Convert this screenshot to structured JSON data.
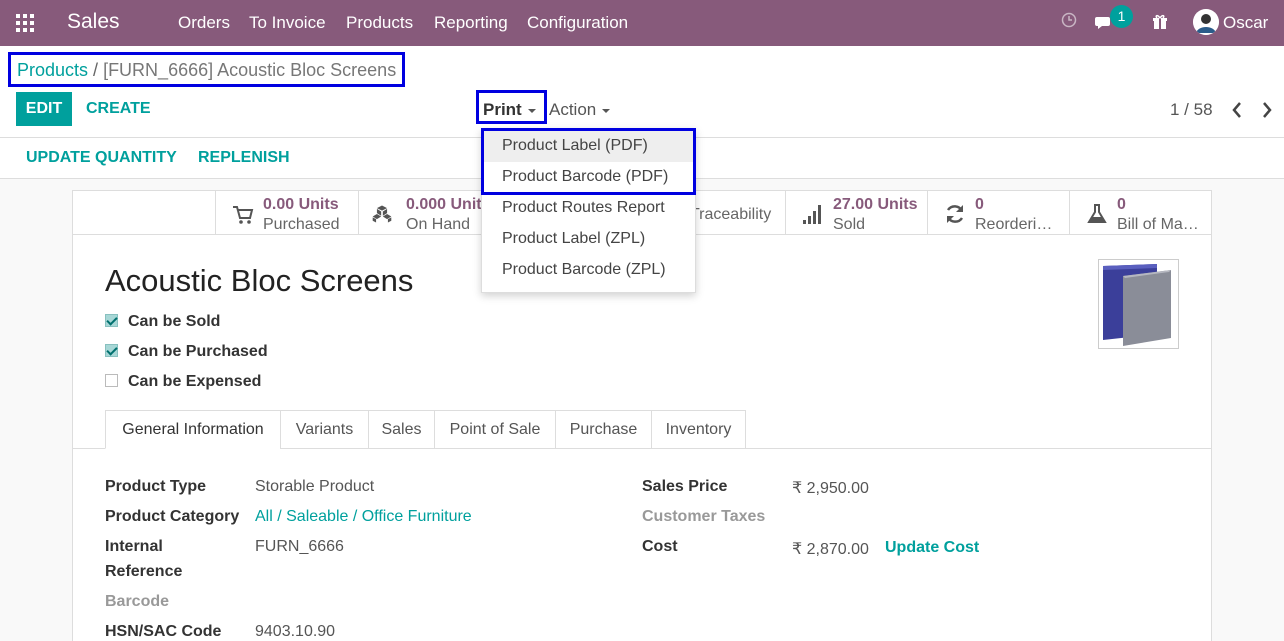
{
  "app": {
    "name": "Sales",
    "menu": [
      "Orders",
      "To Invoice",
      "Products",
      "Reporting",
      "Configuration"
    ],
    "messages_badge": "1",
    "user": "Oscar"
  },
  "breadcrumb": {
    "parent": "Products",
    "separator": "/",
    "current": "[FURN_6666] Acoustic Bloc Screens"
  },
  "toolbar": {
    "edit": "EDIT",
    "create": "CREATE",
    "print": "Print",
    "action": "Action",
    "pager": "1 / 58"
  },
  "print_menu": {
    "items": [
      "Product Label (PDF)",
      "Product Barcode (PDF)",
      "Product Routes Report",
      "Product Label (ZPL)",
      "Product Barcode (ZPL)"
    ]
  },
  "status_buttons": [
    "UPDATE QUANTITY",
    "REPLENISH"
  ],
  "smart_buttons": [
    {
      "value": "0.00 Units",
      "label": "Purchased",
      "icon": "cart-icon"
    },
    {
      "value": "0.000 Units",
      "label": "On Hand",
      "icon": "cubes-icon"
    },
    {
      "value": "",
      "label": "Traceability",
      "icon": "traceability-icon"
    },
    {
      "value": "27.00 Units",
      "label": "Sold",
      "icon": "signal-icon"
    },
    {
      "value": "0",
      "label": "Reordering Rules",
      "icon": "refresh-icon"
    },
    {
      "value": "0",
      "label": "Bill of Materials",
      "icon": "flask-icon"
    }
  ],
  "product": {
    "name": "Acoustic Bloc Screens",
    "checkboxes": [
      {
        "label": "Can be Sold",
        "checked": true
      },
      {
        "label": "Can be Purchased",
        "checked": true
      },
      {
        "label": "Can be Expensed",
        "checked": false
      }
    ]
  },
  "tabs": [
    "General Information",
    "Variants",
    "Sales",
    "Point of Sale",
    "Purchase",
    "Inventory"
  ],
  "fields": {
    "product_type_label": "Product Type",
    "product_type": "Storable Product",
    "product_category_label": "Product Category",
    "product_category": "All / Saleable / Office Furniture",
    "internal_reference_label": "Internal",
    "internal_reference_label2": "Reference",
    "internal_reference": "FURN_6666",
    "barcode_label": "Barcode",
    "hsn_label": "HSN/SAC Code",
    "hsn": "9403.10.90",
    "sales_price_label": "Sales Price",
    "sales_price": "₹ 2,950.00",
    "customer_taxes_label": "Customer Taxes",
    "cost_label": "Cost",
    "cost": "₹ 2,870.00",
    "update_cost": "Update Cost"
  },
  "colors": {
    "navbar": "#875a7b",
    "accent": "#00a09d",
    "highlight_box": "#0000e0"
  }
}
